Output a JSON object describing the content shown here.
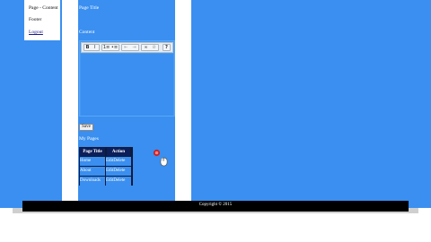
{
  "nav": {
    "items": [
      {
        "label": "Page - Content",
        "underline": false
      },
      {
        "label": "Footer",
        "underline": false
      },
      {
        "label": "Logout",
        "underline": true
      }
    ]
  },
  "form": {
    "page_title_label": "Page Title",
    "content_label": "Content",
    "save_label": "Save"
  },
  "toolbar": {
    "bold": "B",
    "italic": "I",
    "ordered_list": "1≡",
    "unordered_list": "•≡",
    "outdent": "⇤",
    "indent": "⇥",
    "link": "∞",
    "unlink": "⊘",
    "help": "?"
  },
  "pages": {
    "heading": "My Pages",
    "columns": [
      "Page Title",
      "Action"
    ],
    "rows": [
      {
        "title": "Home",
        "action": "EditDelete"
      },
      {
        "title": "About",
        "action": "EditDelete"
      },
      {
        "title": "Downloads",
        "action": "EditDelete"
      }
    ]
  },
  "footer": {
    "text": "Copyright © 2015"
  },
  "colors": {
    "background": "#3a8ff0",
    "table_header": "#0c1f5a",
    "footer": "#000000"
  }
}
